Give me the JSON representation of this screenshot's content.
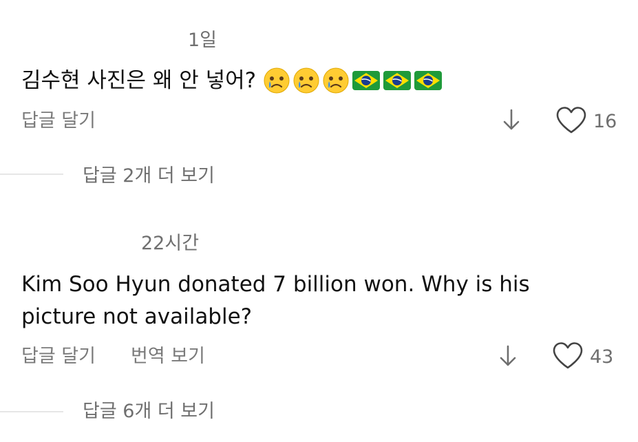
{
  "comments": [
    {
      "timestamp": "1일",
      "text": "김수현 사진은 왜 안 넣어?",
      "emojis": [
        "crying-face",
        "crying-face",
        "crying-face",
        "brazil-flag",
        "brazil-flag",
        "brazil-flag"
      ],
      "reply_label": "답글 달기",
      "like_count": "16",
      "more_replies": "답글 2개 더 보기"
    },
    {
      "timestamp": "22시간",
      "text_line1": "Kim Soo Hyun donated 7 billion won. Why is his",
      "text_line2": "picture not available?",
      "reply_label": "답글 달기",
      "translate_label": "번역 보기",
      "like_count": "43",
      "more_replies": "답글 6개 더 보기"
    }
  ],
  "colors": {
    "text_primary": "#111111",
    "text_secondary": "#6f6f6f",
    "divider": "#e6e6e6",
    "emoji_face": "#ffcc33",
    "emoji_tear": "#3a8ee6",
    "flag_green": "#1f9a3a",
    "flag_yellow": "#ffdf00",
    "flag_blue": "#1a3d8f"
  },
  "icons": [
    "down-arrow-icon",
    "heart-icon"
  ]
}
